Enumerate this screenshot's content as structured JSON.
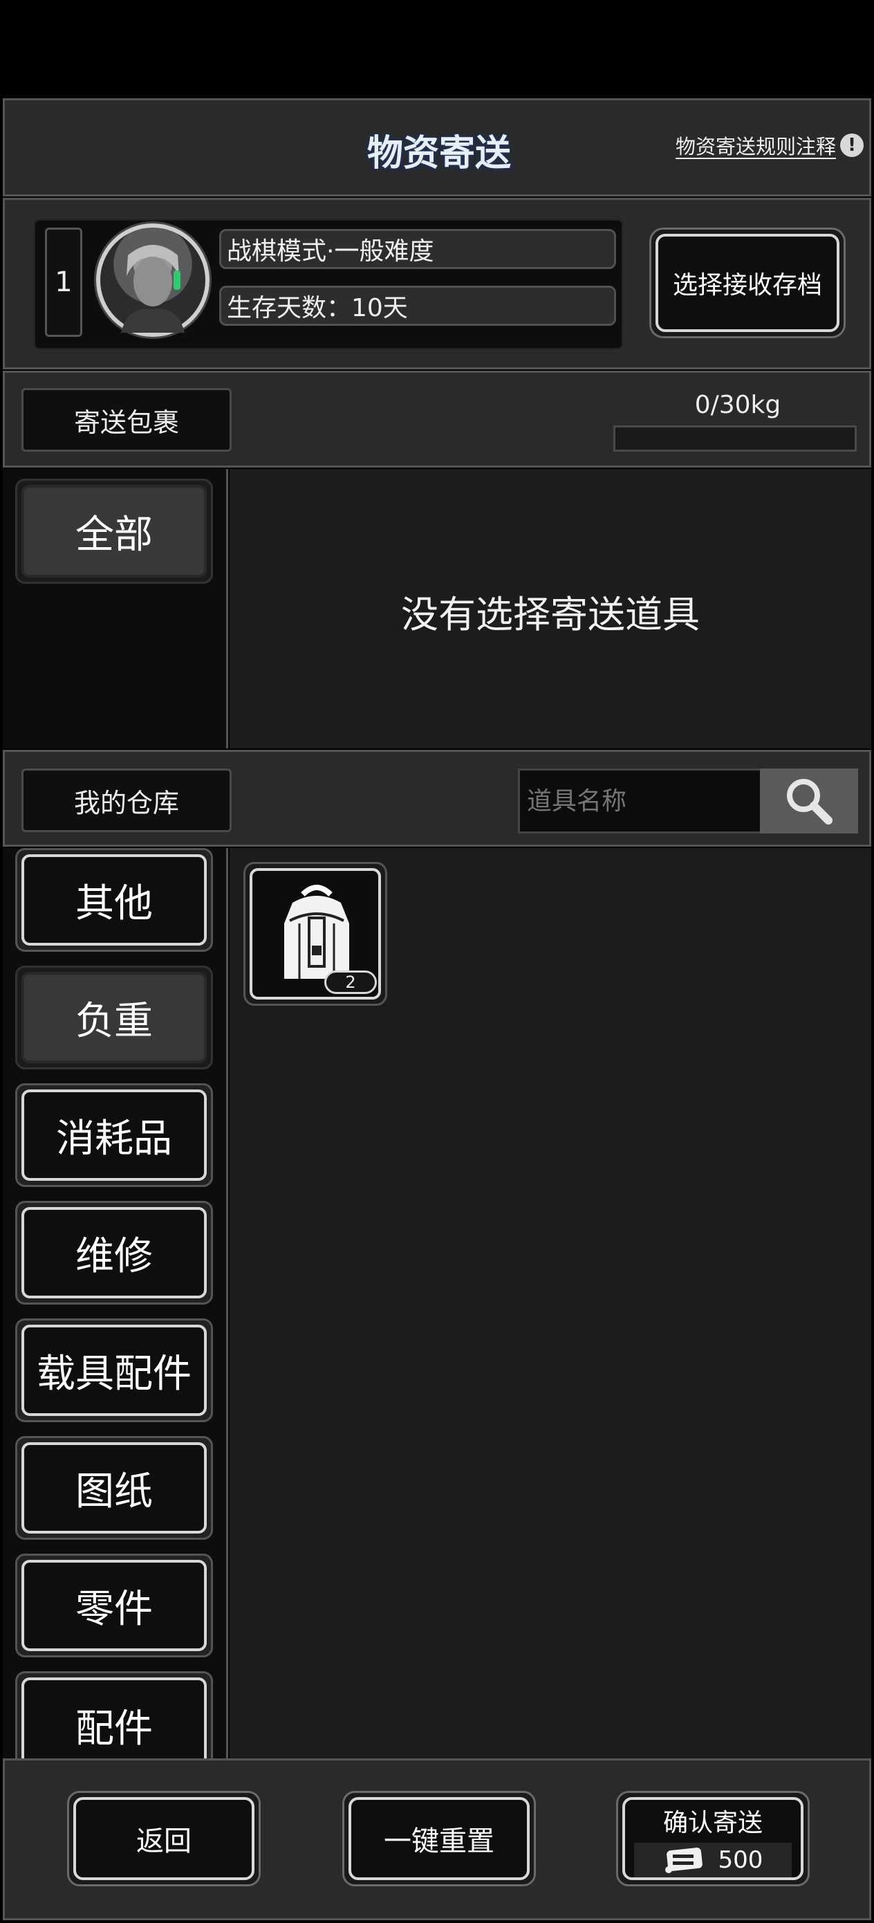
{
  "header": {
    "title": "物资寄送",
    "rules_link": "物资寄送规则注释",
    "rules_icon": "exclamation-icon"
  },
  "save_slot": {
    "slot_number": "1",
    "mode": "战棋模式·一般难度",
    "survival_days": "生存天数：10天",
    "select_button": "选择接收存档"
  },
  "package": {
    "label": "寄送包裹",
    "weight": "0/30kg",
    "weight_fraction": 0,
    "tabs": [
      {
        "label": "全部",
        "selected": true
      }
    ],
    "empty_message": "没有选择寄送道具"
  },
  "warehouse": {
    "label": "我的仓库",
    "search_placeholder": "道具名称",
    "search_icon": "search-icon",
    "tabs": [
      {
        "label": "其他",
        "selected": false
      },
      {
        "label": "负重",
        "selected": true
      },
      {
        "label": "消耗品",
        "selected": false
      },
      {
        "label": "维修",
        "selected": false
      },
      {
        "label": "载具配件",
        "selected": false
      },
      {
        "label": "图纸",
        "selected": false
      },
      {
        "label": "零件",
        "selected": false
      },
      {
        "label": "配件",
        "selected": false
      }
    ],
    "items": [
      {
        "icon": "backpack-icon",
        "count": "2"
      }
    ]
  },
  "footer": {
    "back_button": "返回",
    "reset_button": "一键重置",
    "confirm_button": "确认寄送",
    "cost": "500",
    "cost_icon": "ticket-icon"
  }
}
